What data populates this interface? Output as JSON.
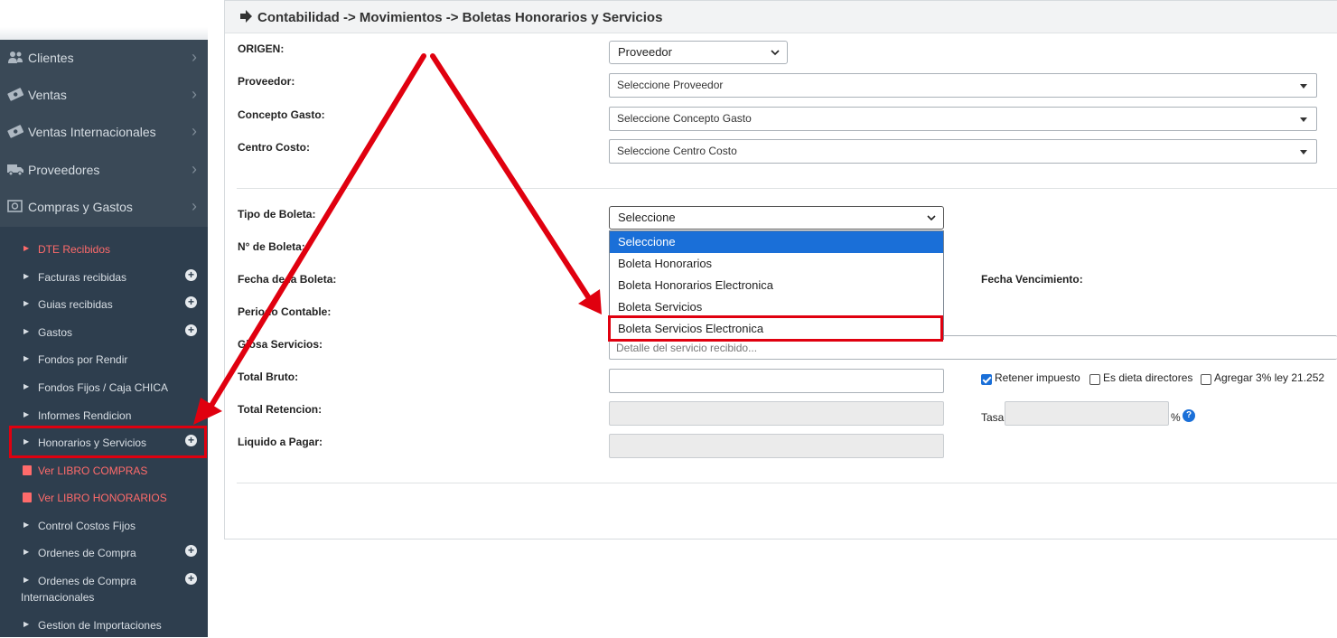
{
  "sidebar": {
    "nav": [
      {
        "label": "Clientes",
        "icon": "users-icon"
      },
      {
        "label": "Ventas",
        "icon": "money-icon"
      },
      {
        "label": "Ventas Internacionales",
        "icon": "money-icon"
      },
      {
        "label": "Proveedores",
        "icon": "truck-icon"
      },
      {
        "label": "Compras y Gastos",
        "icon": "money-bill-icon"
      }
    ],
    "chevron": "›",
    "sub": [
      {
        "label": "DTE Recibidos",
        "plus": false,
        "style": "red-caret"
      },
      {
        "label": "Facturas recibidas",
        "plus": true
      },
      {
        "label": "Guias recibidas",
        "plus": true
      },
      {
        "label": "Gastos",
        "plus": true
      },
      {
        "label": "Fondos por Rendir",
        "plus": false
      },
      {
        "label": "Fondos Fijos / Caja CHICA",
        "plus": false
      },
      {
        "label": "Informes Rendicion",
        "plus": false
      },
      {
        "label": "Honorarios y Servicios",
        "plus": true
      },
      {
        "label": "Ver LIBRO COMPRAS",
        "plus": false,
        "style": "red-book"
      },
      {
        "label": "Ver LIBRO HONORARIOS",
        "plus": false,
        "style": "red-book"
      },
      {
        "label": "Control Costos Fijos",
        "plus": false
      },
      {
        "label": "Ordenes de Compra",
        "plus": true
      },
      {
        "label": "Ordenes de Compra",
        "label2": "Internacionales",
        "plus": true
      },
      {
        "label": "Gestion de Importaciones",
        "plus": false
      }
    ]
  },
  "header": {
    "title": "Contabilidad -> Movimientos -> Boletas Honorarios y Servicios"
  },
  "form": {
    "origen": {
      "label": "ORIGEN:",
      "value": "Proveedor"
    },
    "proveedor": {
      "label": "Proveedor:",
      "value": "Seleccione Proveedor"
    },
    "concepto": {
      "label": "Concepto Gasto:",
      "value": "Seleccione Concepto Gasto"
    },
    "centro": {
      "label": "Centro Costo:",
      "value": "Seleccione Centro Costo"
    },
    "tipo": {
      "label": "Tipo de Boleta:",
      "value": "Seleccione"
    },
    "numero": {
      "label": "N° de Boleta:"
    },
    "fecha": {
      "label": "Fecha de la Boleta:"
    },
    "vencimiento": {
      "label": "Fecha Vencimiento:"
    },
    "periodo": {
      "label": "Periodo Contable:"
    },
    "glosa": {
      "label": "Glosa Servicios:",
      "placeholder": "Detalle del servicio recibido..."
    },
    "bruto": {
      "label": "Total Bruto:"
    },
    "retencion": {
      "label": "Total Retencion:"
    },
    "liquido": {
      "label": "Liquido a Pagar:"
    },
    "retener": {
      "label": "Retener impuesto",
      "checked": true
    },
    "dieta": {
      "label": "Es dieta directores",
      "checked": false
    },
    "agregar": {
      "label": "Agregar 3% ley 21.252",
      "checked": false
    },
    "tasa": {
      "label": "Tasa",
      "unit": "%",
      "help": "?"
    }
  },
  "dropdown_options": [
    "Seleccione",
    "Boleta Honorarios",
    "Boleta Honorarios Electronica",
    "Boleta Servicios",
    "Boleta Servicios Electronica"
  ],
  "colors": {
    "annotation": "#e0000f",
    "selected_option": "#1a6fd8",
    "sidebar": "#2e3e4e"
  }
}
